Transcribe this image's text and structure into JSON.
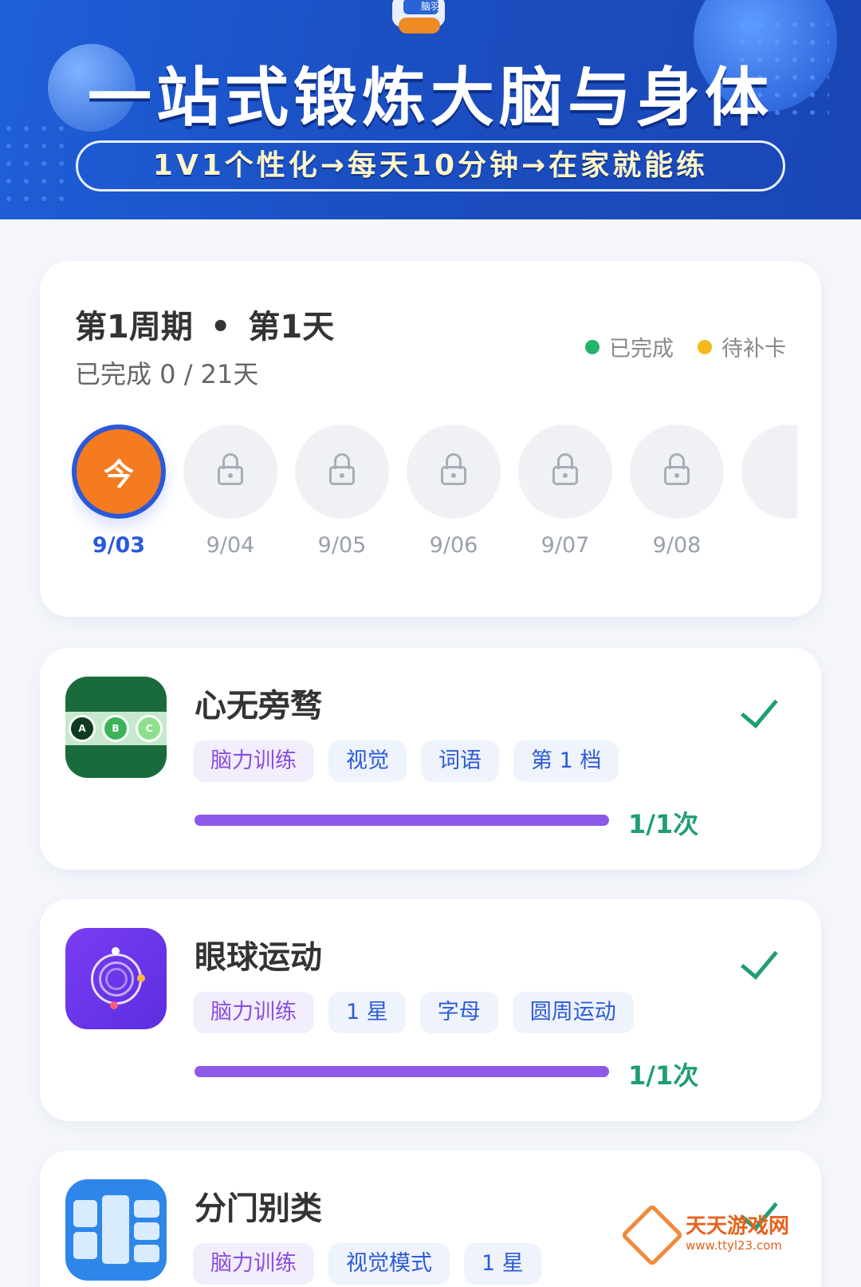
{
  "banner": {
    "mascot_tag": "脑羽",
    "headline": "一站式锻炼大脑与身体",
    "subtitle": "1V1个性化→每天10分钟→在家就能练"
  },
  "period": {
    "cycle": "第1周期",
    "separator": "•",
    "day": "第1天",
    "completed_text": "已完成 0 / 21天",
    "legend": [
      {
        "label": "已完成",
        "color": "#22b36f"
      },
      {
        "label": "待补卡",
        "color": "#f4b81c"
      }
    ],
    "days": [
      {
        "date": "9/03",
        "label": "今",
        "state": "today"
      },
      {
        "date": "9/04",
        "state": "locked"
      },
      {
        "date": "9/05",
        "state": "locked"
      },
      {
        "date": "9/06",
        "state": "locked"
      },
      {
        "date": "9/07",
        "state": "locked"
      },
      {
        "date": "9/08",
        "state": "locked"
      }
    ]
  },
  "tasks": [
    {
      "name": "心无旁骛",
      "icon": "abc-balls-icon",
      "tags": [
        "脑力训练",
        "视觉",
        "词语",
        "第 1 档"
      ],
      "progress": 1.0,
      "count": "1/1次",
      "done": true,
      "icon_letters": [
        "A",
        "B",
        "C"
      ]
    },
    {
      "name": "眼球运动",
      "icon": "orbit-icon",
      "tags": [
        "脑力训练",
        "1 星",
        "字母",
        "圆周运动"
      ],
      "progress": 1.0,
      "count": "1/1次",
      "done": true
    },
    {
      "name": "分门别类",
      "icon": "grid-blocks-icon",
      "tags": [
        "脑力训练",
        "视觉模式",
        "1 星"
      ],
      "done": true
    }
  ],
  "watermark": {
    "title": "天天游戏网",
    "url": "www.ttyl23.com"
  },
  "colors": {
    "accent": "#2a59d9",
    "today_fill": "#f57b20",
    "progress": "#8e58e8",
    "done_green": "#1f9e73"
  }
}
